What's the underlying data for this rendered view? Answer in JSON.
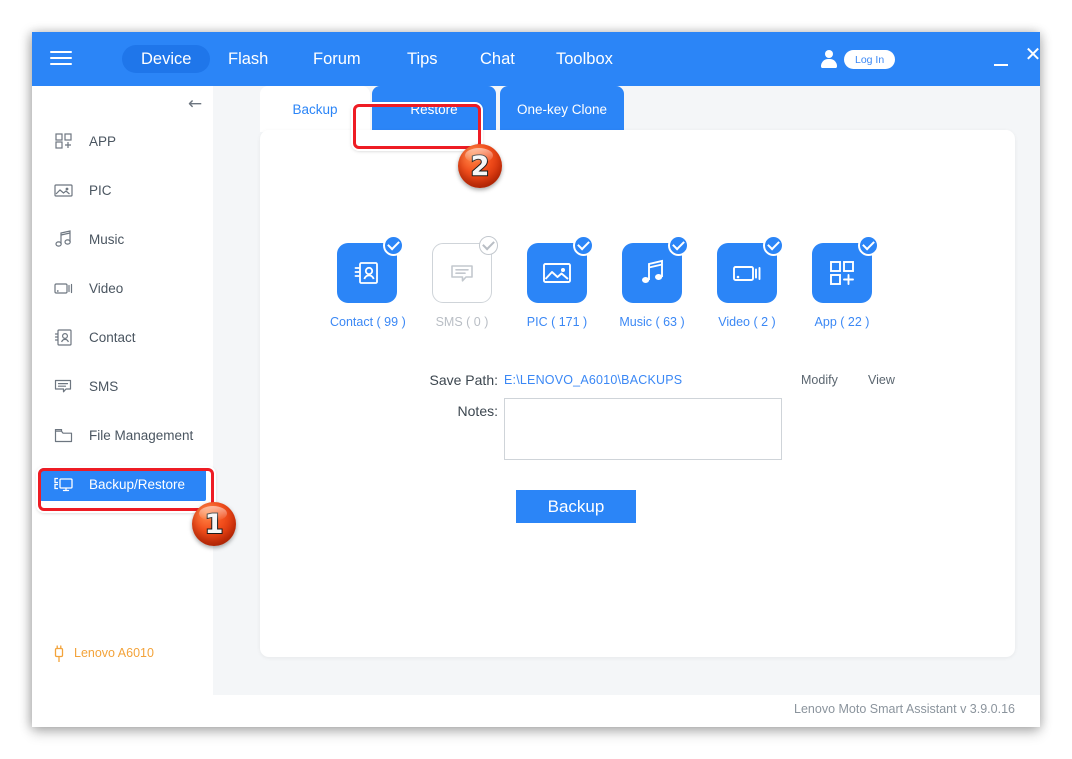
{
  "header": {
    "menu_icon": "hamburger-icon",
    "nav": [
      {
        "label": "Device",
        "active": true
      },
      {
        "label": "Flash",
        "active": false
      },
      {
        "label": "Forum",
        "active": false
      },
      {
        "label": "Tips",
        "active": false
      },
      {
        "label": "Chat",
        "active": false
      },
      {
        "label": "Toolbox",
        "active": false
      }
    ],
    "account_icon": "user-icon",
    "login_label": "Log In",
    "minimize_icon": "minimize-icon",
    "close_icon": "close-icon"
  },
  "sidebar": {
    "collapse_icon": "arrow-left-icon",
    "items": [
      {
        "label": "APP",
        "icon": "apps-grid-icon",
        "active": false
      },
      {
        "label": "PIC",
        "icon": "image-icon",
        "active": false
      },
      {
        "label": "Music",
        "icon": "music-note-icon",
        "active": false
      },
      {
        "label": "Video",
        "icon": "video-camera-icon",
        "active": false
      },
      {
        "label": "Contact",
        "icon": "contact-card-icon",
        "active": false
      },
      {
        "label": "SMS",
        "icon": "message-icon",
        "active": false
      },
      {
        "label": "File Management",
        "icon": "folder-icon",
        "active": false
      },
      {
        "label": "Backup/Restore",
        "icon": "backup-restore-icon",
        "active": true
      }
    ],
    "device": {
      "name": "Lenovo A6010",
      "icon": "usb-plug-icon",
      "color": "#f3a33a"
    }
  },
  "main": {
    "tabs": [
      {
        "label": "Backup",
        "active": true
      },
      {
        "label": "Restore",
        "active": false
      },
      {
        "label": "One-key Clone",
        "active": false
      }
    ],
    "categories": [
      {
        "label": "Contact ( 99 )",
        "icon": "contact-card-icon",
        "selected": true,
        "disabled": false
      },
      {
        "label": "SMS ( 0 )",
        "icon": "message-icon",
        "selected": false,
        "disabled": true
      },
      {
        "label": "PIC ( 171 )",
        "icon": "image-icon",
        "selected": true,
        "disabled": false
      },
      {
        "label": "Music ( 63 )",
        "icon": "music-note-icon",
        "selected": true,
        "disabled": false
      },
      {
        "label": "Video ( 2 )",
        "icon": "video-camera-icon",
        "selected": true,
        "disabled": false
      },
      {
        "label": "App ( 22 )",
        "icon": "apps-grid-icon",
        "selected": true,
        "disabled": false
      }
    ],
    "form": {
      "save_path_label": "Save Path:",
      "save_path_value": "E:\\LENOVO_A6010\\BACKUPS",
      "modify_label": "Modify",
      "view_label": "View",
      "notes_label": "Notes:",
      "notes_value": "",
      "notes_placeholder": "",
      "backup_button_label": "Backup"
    }
  },
  "footer": {
    "version_text": "Lenovo Moto Smart Assistant v 3.9.0.16"
  },
  "annotations": {
    "markers": [
      {
        "number": "1",
        "target": "sidebar-item-backup-restore"
      },
      {
        "number": "2",
        "target": "tab-restore"
      }
    ],
    "highlight_color": "#ee1c24"
  },
  "colors": {
    "accent_blue": "#2b85f7",
    "link_blue": "#3b88f5",
    "device_orange": "#f3a33a",
    "annotation_red": "#ee1c24"
  }
}
